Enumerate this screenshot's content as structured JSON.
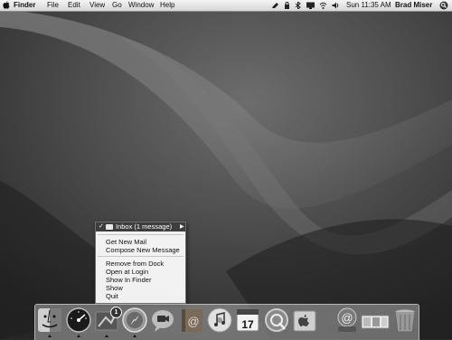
{
  "menubar": {
    "app": "Finder",
    "menus": [
      "File",
      "Edit",
      "View",
      "Go",
      "Window",
      "Help"
    ],
    "clock": "Sun 11:35 AM",
    "user": "Brad Miser"
  },
  "dock_menu": {
    "header": "Inbox (1 message)",
    "items": [
      "Get New Mail",
      "Compose New Message",
      "Remove from Dock",
      "Open at Login",
      "Show In Finder",
      "Show",
      "Quit"
    ]
  },
  "dock": {
    "mail_badge": "1",
    "ical_day": "17",
    "icons": [
      "finder-icon",
      "dashboard-icon",
      "mail-icon",
      "safari-icon",
      "ichat-icon",
      "address-book-icon",
      "itunes-icon",
      "ical-icon",
      "quicktime-icon",
      "system-preferences-icon",
      "network-icon",
      "documents-stack-icon",
      "trash-icon"
    ]
  }
}
